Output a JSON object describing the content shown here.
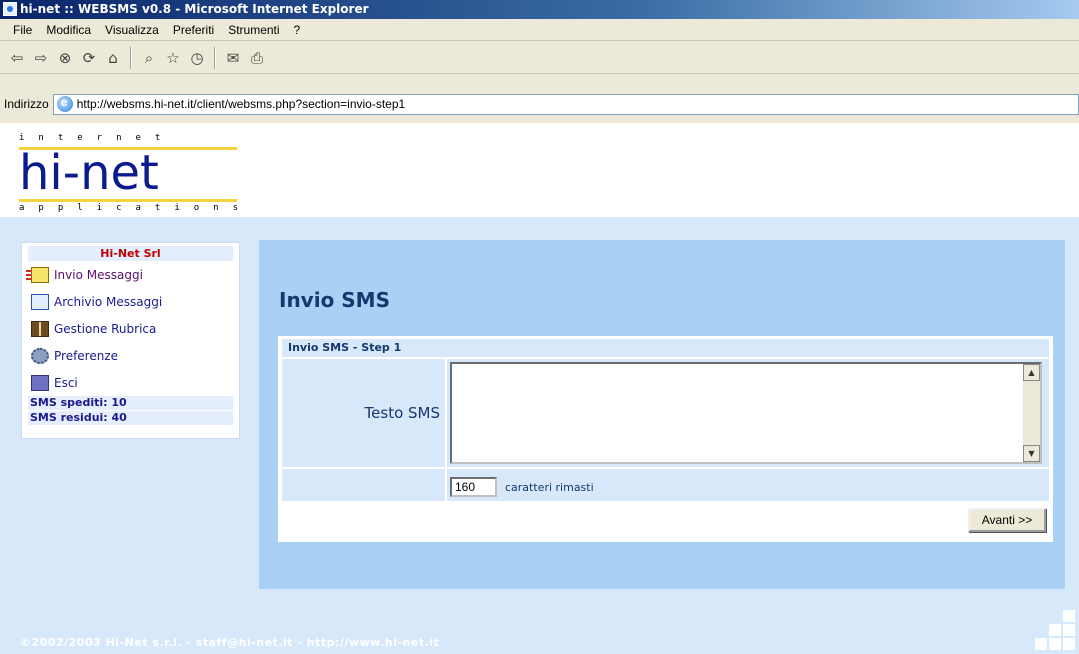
{
  "window": {
    "title": "hi-net :: WEBSMS v0.8 - Microsoft Internet Explorer"
  },
  "menubar": {
    "items": [
      "File",
      "Modifica",
      "Visualizza",
      "Preferiti",
      "Strumenti",
      "?"
    ]
  },
  "toolbar": {
    "icons": [
      "back-icon",
      "forward-icon",
      "stop-icon",
      "refresh-icon",
      "home-icon",
      "search-icon",
      "favorites-icon",
      "history-icon",
      "mail-icon",
      "print-icon"
    ]
  },
  "address": {
    "label": "Indirizzo",
    "url": "http://websms.hi-net.it/client/websms.php?section=invio-step1"
  },
  "logo": {
    "top": "internet",
    "main": "hi-net",
    "bottom": "applications"
  },
  "sidebar": {
    "company": "Hi-Net Srl",
    "items": [
      {
        "label": "Invio Messaggi",
        "icon": "send-mail-icon"
      },
      {
        "label": "Archivio Messaggi",
        "icon": "archive-icon"
      },
      {
        "label": "Gestione Rubrica",
        "icon": "address-book-icon"
      },
      {
        "label": "Preferenze",
        "icon": "preferences-icon"
      },
      {
        "label": "Esci",
        "icon": "exit-icon"
      }
    ],
    "sent": "SMS spediti: 10",
    "remaining": "SMS residui: 40"
  },
  "main": {
    "title": "Invio SMS",
    "form_header": "Invio SMS - Step 1",
    "text_label": "Testo SMS",
    "text_value": "",
    "counter_value": "160",
    "counter_label": "caratteri rimasti",
    "submit_label": "Avanti >>"
  },
  "footer": {
    "text": "©2002/2003 Hi-Net s.r.l. - staff@hi-net.it - http://www.hi-net.it"
  },
  "colors": {
    "page_bg": "#d7e8fb",
    "panel_bg": "#a9d0f5",
    "title_color": "#16386e",
    "company_color": "#c00000"
  }
}
